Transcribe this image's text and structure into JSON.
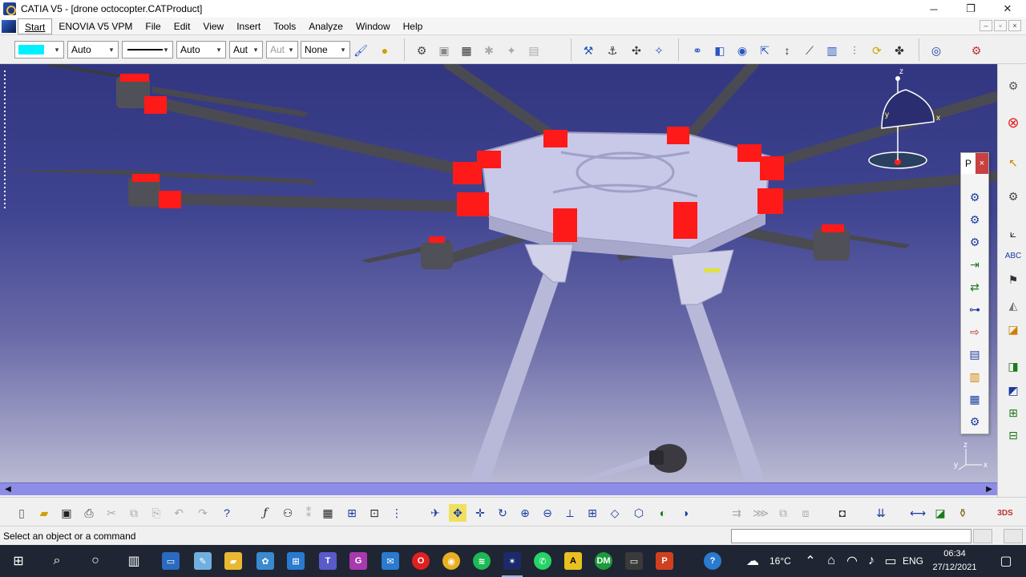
{
  "window": {
    "title": "CATIA V5 - [drone octocopter.CATProduct]",
    "controls": {
      "minimize": "─",
      "maximize": "❐",
      "close": "✕"
    }
  },
  "menubar": {
    "items": [
      "Start",
      "ENOVIA V5 VPM",
      "File",
      "Edit",
      "View",
      "Insert",
      "Tools",
      "Analyze",
      "Window",
      "Help"
    ],
    "doc_controls": {
      "minimize": "–",
      "restore": "▫",
      "close": "×"
    }
  },
  "toolbar": {
    "color_value": "#00f0ff",
    "line_type_value": "",
    "combos": {
      "thickness": "Auto",
      "line_weight": "Auto",
      "layer_a": "Aut",
      "layer_b": "Aut",
      "render_style": "None"
    },
    "dropdown_arrow": "▾"
  },
  "viewport": {
    "model": "drone octocopter",
    "compass_axes": {
      "z": "z",
      "y": "y",
      "x": "x"
    },
    "mini_axes": {
      "z": "z",
      "y": "y",
      "x": "x"
    }
  },
  "palette": {
    "label": "P",
    "close": "×"
  },
  "status": {
    "message": "Select an object or a command",
    "command_input": ""
  },
  "taskbar": {
    "weather": "16°C",
    "language": "ENG",
    "time": "06:34",
    "date": "27/12/2021"
  },
  "colors": {
    "viewport_top": "#323680",
    "part_frame": "#c8c8e8",
    "part_clamp": "#ff1a1a",
    "arm_tube": "#505058",
    "taskbar_bg": "#1f2532"
  }
}
